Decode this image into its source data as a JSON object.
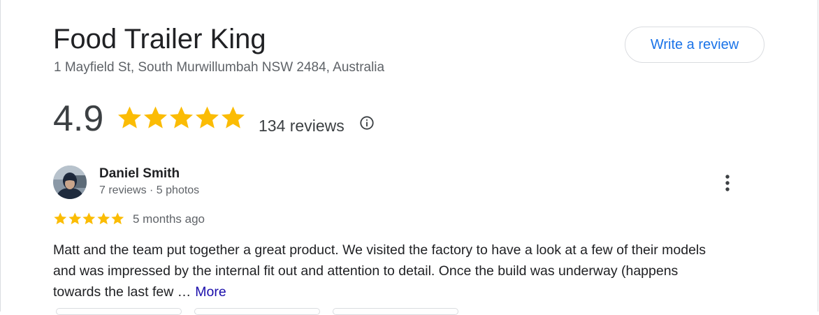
{
  "business": {
    "name": "Food Trailer King",
    "address": "1 Mayfield St, South Murwillumbah NSW 2484, Australia"
  },
  "actions": {
    "write_review_label": "Write a review"
  },
  "summary": {
    "rating": "4.9",
    "stars": 5,
    "review_count": "134 reviews",
    "star_color": "#fbbc04"
  },
  "review": {
    "author": "Daniel Smith",
    "author_meta": "7 reviews · 5 photos",
    "stars": 5,
    "time": "5 months ago",
    "text": "Matt and the team put together a great product. We visited the factory to have a look at a few of their models and was impressed by the internal fit out and attention to detail. Once the build was underway (happens towards the last few …",
    "more_label": "More"
  },
  "icons": {
    "info": "info-icon",
    "more": "more-vert-icon",
    "star": "star-icon"
  }
}
